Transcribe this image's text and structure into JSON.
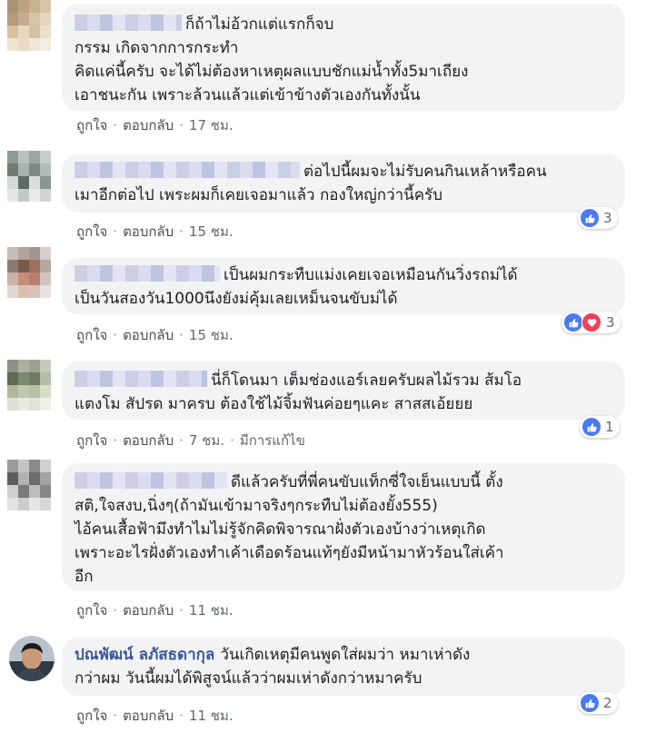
{
  "comments": [
    {
      "text": "ก็ถ้าไม่อ้วกแต่แรกก็จบ",
      "lines": [
        "กรรม เกิดจากการกระทำ",
        "คิดแค่นี้ครับ จะได้ไม่ต้องหาเหตุผลแบบชักแม่น้ำทั้ง5มาเถียง",
        "เอาชนะกัน เพราะล้วนแล้วแต่เข้าข้างตัวเองกันทั้งนั้น"
      ],
      "like": "ถูกใจ",
      "reply": "ตอบกลับ",
      "time": "17 ชม."
    },
    {
      "text": "ต่อไปนี้ผมจะไม่รับคนกินเหล้าหรือคน",
      "lines": [
        "เมาอีกต่อไป เพระผมก็เคยเจอมาแล้ว กองใหญ่กว่านี้ครับ"
      ],
      "like": "ถูกใจ",
      "reply": "ตอบกลับ",
      "time": "15 ชม.",
      "reactions": "3"
    },
    {
      "text": "เป็นผมกระทืบแม่งเคยเจอเหมือนกันวิ่งรถม่ได้",
      "lines": [
        "เป็นวันสองวัน1000นึงยังม่คุ้มเลยเหม็นจนขับม่ได้"
      ],
      "like": "ถูกใจ",
      "reply": "ตอบกลับ",
      "time": "15 ชม.",
      "reactions": "3"
    },
    {
      "text": "นี่ก็โดนมา เต็มช่องแอร์เลยครับผลไม้รวม ส้มโอ",
      "lines": [
        "แตงโม สัปรด มาครบ ต้องใช้ไม้จิ้มฟันค่อยๆแคะ สาสสเอ้ยยย"
      ],
      "like": "ถูกใจ",
      "reply": "ตอบกลับ",
      "time": "7 ชม.",
      "edited": "มีการแก้ไข",
      "reactions": "1"
    },
    {
      "text": "ดีแล้วครับที่พี่คนขับแท็กซี่ใจเย็นแบบนี้ ตั้ง",
      "lines": [
        "สติ,ใจสงบ,นิ่งๆ(ถ้ามันเข้ามาจริงๆกระทืบไม่ต้องยั้ง555)",
        "ไอ้คนเสื้อฟ้ามึงทำไมไม่รู้จักคิดพิจารณาฝั่งตัวเองบ้างว่าเหตุเกิด",
        "เพราะอะไรฝั่งตัวเองทำเค้าเดือดร้อนแท้ๆยังมีหน้ามาหัวร้อนใส่เค้า",
        "อีก"
      ],
      "like": "ถูกใจ",
      "reply": "ตอบกลับ",
      "time": "11 ชม."
    },
    {
      "name": "ปณพัฒน์ ลภัสธดากุล",
      "text": "วันเกิดเหตุมีคนพูดใส่ผมว่า หมาเห่าดัง",
      "lines": [
        "กว่าผม วันนี้ผมได้พิสูจน์แล้วว่าผมเห่าดังกว่าหมาครับ"
      ],
      "like": "ถูกใจ",
      "reply": "ตอบกลับ",
      "time": "11 ชม.",
      "reactions": "2"
    }
  ],
  "colors": {
    "bubble": "#f2f3f5",
    "link": "#385898",
    "like": "#4a7bf0",
    "love": "#f0405a"
  },
  "icons": {
    "like": "thumbs-up-icon",
    "love": "heart-icon"
  }
}
